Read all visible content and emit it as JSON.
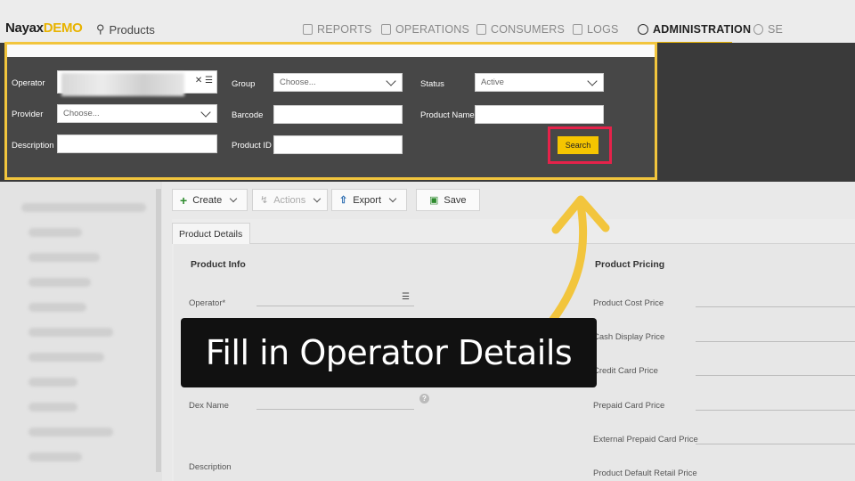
{
  "header": {
    "logo_main": "Nayax",
    "logo_sub": "DEMO",
    "breadcrumb": "Products",
    "nav": [
      {
        "label": "REPORTS",
        "icon": "document-icon"
      },
      {
        "label": "OPERATIONS",
        "icon": "phone-icon"
      },
      {
        "label": "CONSUMERS",
        "icon": "person-card-icon"
      },
      {
        "label": "LOGS",
        "icon": "list-icon"
      },
      {
        "label": "ADMINISTRATION",
        "icon": "dial-icon"
      },
      {
        "label": "SE",
        "icon": "gear-icon"
      }
    ]
  },
  "filter": {
    "operator_label": "Operator",
    "group_label": "Group",
    "group_value": "Choose...",
    "status_label": "Status",
    "status_value": "Active",
    "provider_label": "Provider",
    "provider_value": "Choose...",
    "barcode_label": "Barcode",
    "product_name_label": "Product Name",
    "description_label": "Description",
    "product_id_label": "Product ID",
    "search_label": "Search"
  },
  "toolbar": {
    "create": "Create",
    "actions": "Actions",
    "export": "Export",
    "save": "Save"
  },
  "tabs": {
    "product_details": "Product Details"
  },
  "form": {
    "product_info": "Product Info",
    "operator_label": "Operator*",
    "dex_name_label": "Dex Name",
    "description_label": "Description",
    "product_pricing": "Product Pricing",
    "cost_price": "Product Cost Price",
    "cash_display_price": "Cash Display Price",
    "credit_card_price": "Credit Card Price",
    "prepaid_card_price": "Prepaid Card Price",
    "external_prepaid_price": "External Prepaid Card Price",
    "default_retail_price": "Product Default Retail Price"
  },
  "annotation": {
    "caption": "Fill in Operator Details",
    "highlight_color": "#f2c53d",
    "search_highlight_color": "#e6224a"
  }
}
